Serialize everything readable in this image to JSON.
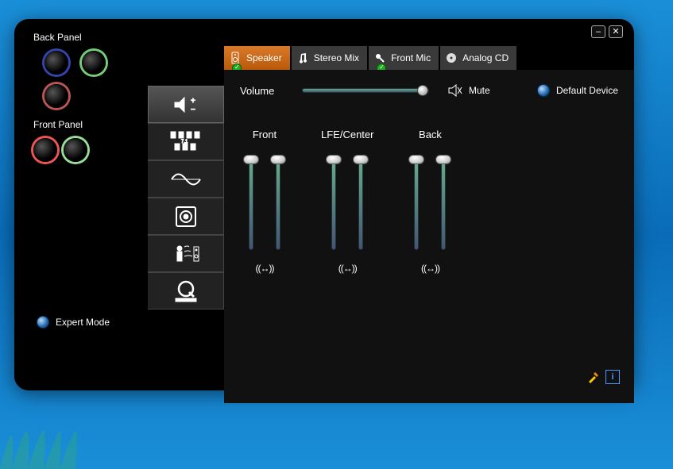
{
  "left_panel": {
    "back_label": "Back Panel",
    "front_label": "Front Panel"
  },
  "tabs": {
    "speaker": "Speaker",
    "stereo_mix": "Stereo Mix",
    "front_mic": "Front Mic",
    "analog_cd": "Analog CD"
  },
  "volume": {
    "label": "Volume",
    "mute_label": "Mute",
    "default_label": "Default Device"
  },
  "channels": {
    "front": "Front",
    "lfe": "LFE/Center",
    "back": "Back",
    "balance_glyph": "((↔))"
  },
  "expert_label": "Expert Mode",
  "icon_names": {
    "sidetab0": "volume-plusminus-icon",
    "sidetab1": "speaker-grid-icon",
    "sidetab2": "sine-wave-icon",
    "sidetab3": "subwoofer-icon",
    "sidetab4": "room-person-icon",
    "sidetab5": "qsound-logo-icon"
  }
}
